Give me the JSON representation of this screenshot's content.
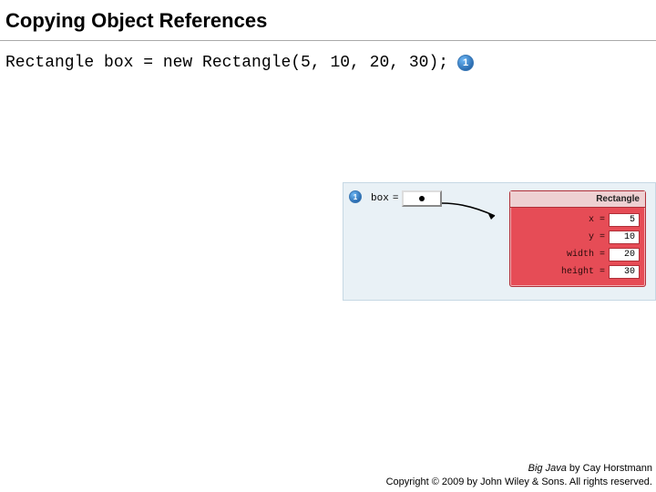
{
  "title": "Copying Object References",
  "code_line": "Rectangle box = new Rectangle(5, 10, 20, 30);",
  "callout_main": "1",
  "diagram": {
    "callout": "1",
    "var_name": "box",
    "equals": "=",
    "object": {
      "type": "Rectangle",
      "fields": [
        {
          "label": "x =",
          "value": "5"
        },
        {
          "label": "y =",
          "value": "10"
        },
        {
          "label": "width =",
          "value": "20"
        },
        {
          "label": "height =",
          "value": "30"
        }
      ]
    }
  },
  "footer": {
    "book": "Big Java",
    "byline": " by Cay Horstmann",
    "copyright": "Copyright © 2009 by John Wiley & Sons. All rights reserved."
  }
}
